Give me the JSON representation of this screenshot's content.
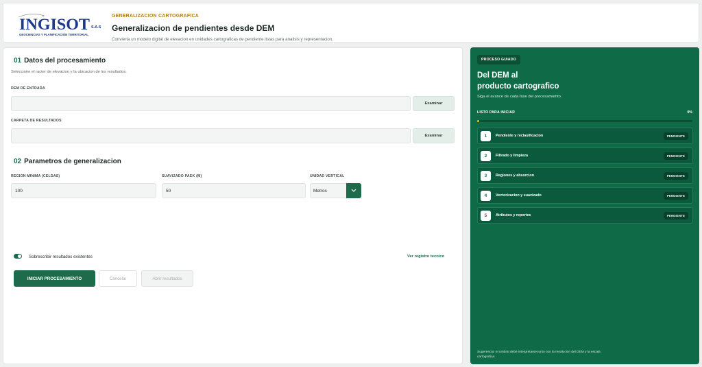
{
  "header": {
    "logo_text": "INGISOT",
    "logo_suffix": "S.A.S",
    "logo_tagline": "GEOCIENCIAS Y PLANIFICACIÓN TERRITORIAL",
    "eyebrow": "GENERALIZACION CARTOGRAFICA",
    "title": "Generalizacion de pendientes desde DEM",
    "subtitle": "Convierta un modelo digital de elevacion en unidades cartograficas de pendiente listas para analisis y representacion."
  },
  "section1": {
    "number": "01",
    "title": "Datos del procesamiento",
    "description": "Seleccione el racter de elevacion y la ubicacion de los resultados.",
    "dem_label": "DEM DE ENTRADA",
    "dem_value": "",
    "output_label": "CARPETA DE RESULTADOS",
    "output_value": "",
    "browse_label": "Examinar"
  },
  "section2": {
    "number": "02",
    "title": "Parametros de generalizacion",
    "min_region_label": "REGION MINIMA (CELDAS)",
    "min_region_value": "100",
    "paek_label": "SUAVIZADO PAEK (M)",
    "paek_value": "50",
    "unit_label": "UNIDAD VERTICAL",
    "unit_value": "Metros",
    "overwrite_label": "Sobrescribir resultados existentes",
    "overwrite_on": true,
    "log_link": "Ver registro tecnico"
  },
  "actions": {
    "start": "INICIAR PROCESAMIENTO",
    "cancel": "Cancelar",
    "open_results": "Abrir resultados"
  },
  "guide": {
    "badge": "PROCESO GUIADO",
    "title_line1": "Del DEM al",
    "title_line2": "producto cartografico",
    "subtitle": "Siga el avance de cada fase del procesamiento.",
    "progress_label": "LISTO PARA INICIAR",
    "progress_text": "0%",
    "progress": 0,
    "steps": [
      {
        "num": "1",
        "label": "Pendiente y reclasificacion",
        "status": "PENDIENTE"
      },
      {
        "num": "2",
        "label": "Filtrado y limpieza",
        "status": "PENDIENTE"
      },
      {
        "num": "3",
        "label": "Regiones y absorcion",
        "status": "PENDIENTE"
      },
      {
        "num": "4",
        "label": "Vectorizacion y suavizado",
        "status": "PENDIENTE"
      },
      {
        "num": "5",
        "label": "Atributos y reportes",
        "status": "PENDIENTE"
      }
    ],
    "footer": "Sugerencia: el umbral debe interpretarse junto con la resolucion del DEM y la escala cartografica."
  },
  "colors": {
    "brand_green": "#1e6b4b",
    "panel_green": "#0f6a48",
    "accent_gold": "#b07d1a",
    "progress_yellow": "#f2c12e"
  }
}
